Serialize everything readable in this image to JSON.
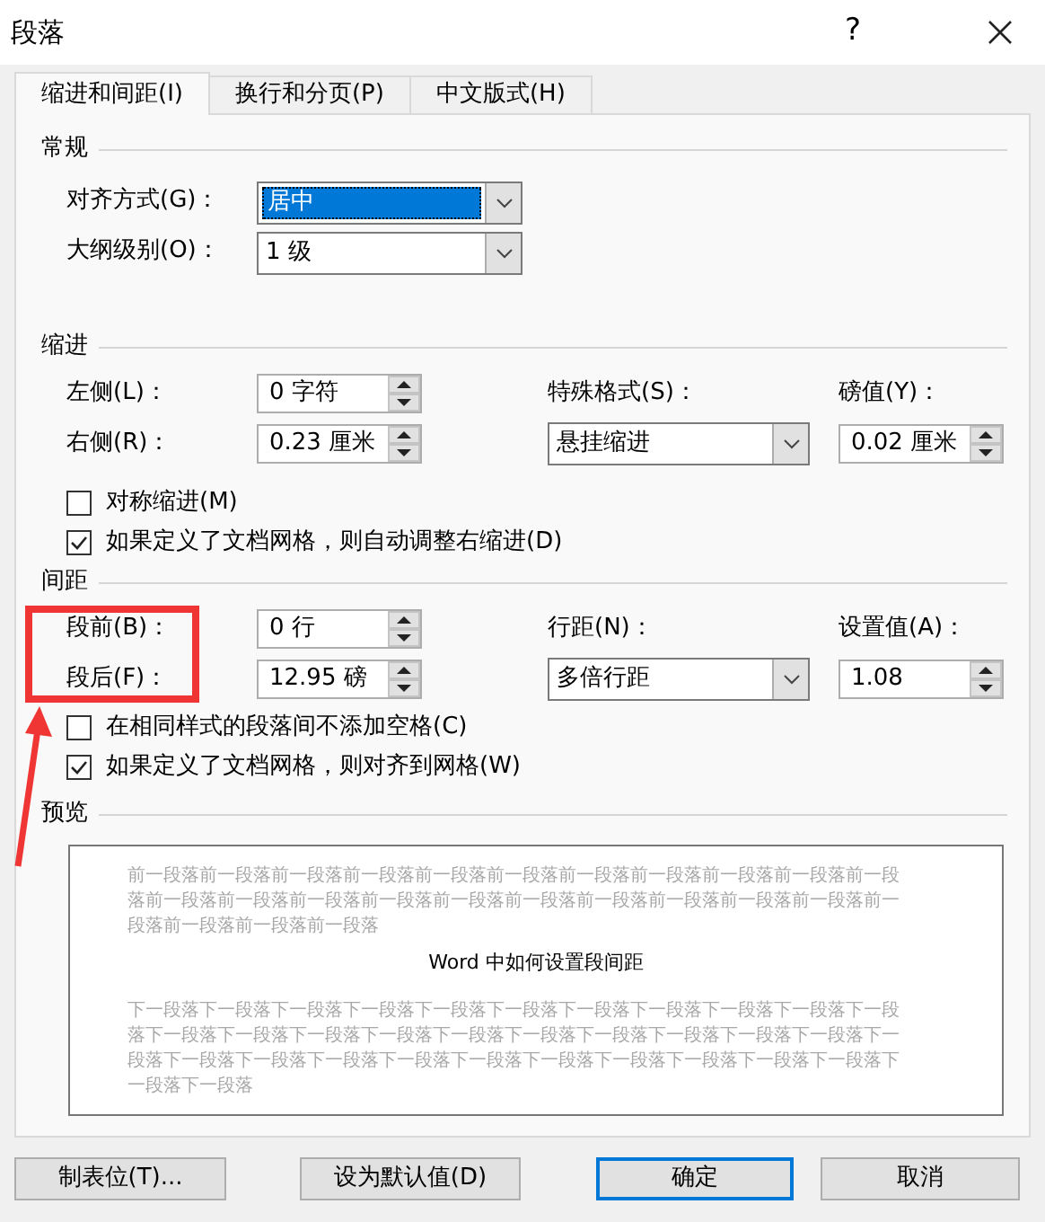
{
  "window": {
    "title": "段落",
    "help": "?"
  },
  "tabs": [
    {
      "label": "缩进和间距(I)",
      "selected": true
    },
    {
      "label": "换行和分页(P)",
      "selected": false
    },
    {
      "label": "中文版式(H)",
      "selected": false
    }
  ],
  "general": {
    "heading": "常规",
    "fields": [
      {
        "label": "对齐方式(G)：",
        "value": "居中",
        "highlighted": true
      },
      {
        "label": "大纲级别(O)：",
        "value": "1 级",
        "highlighted": false
      }
    ]
  },
  "indentation": {
    "heading": "缩进",
    "left": {
      "label": "左侧(L)：",
      "value": "0 字符"
    },
    "right": {
      "label": "右侧(R)：",
      "value": "0.23 厘米"
    },
    "special": {
      "label": "特殊格式(S)：",
      "value": "悬挂缩进"
    },
    "by": {
      "label": "磅值(Y)：",
      "value": "0.02 厘米"
    },
    "checkboxes": [
      {
        "label": "对称缩进(M)",
        "checked": false
      },
      {
        "label": "如果定义了文档网格，则自动调整右缩进(D)",
        "checked": true
      }
    ]
  },
  "spacing": {
    "heading": "间距",
    "before": {
      "label": "段前(B)：",
      "value": "0 行"
    },
    "after": {
      "label": "段后(F)：",
      "value": "12.95 磅"
    },
    "line_spacing": {
      "label": "行距(N)：",
      "value": "多倍行距"
    },
    "at": {
      "label": "设置值(A)：",
      "value": "1.08"
    },
    "checkboxes": [
      {
        "label": "在相同样式的段落间不添加空格(C)",
        "checked": false
      },
      {
        "label": "如果定义了文档网格，则对齐到网格(W)",
        "checked": true
      }
    ]
  },
  "preview": {
    "heading": "预览",
    "previous_lines": [
      "前一段落前一段落前一段落前一段落前一段落前一段落前一段落前一段落前一段落前一段落前一段",
      "落前一段落前一段落前一段落前一段落前一段落前一段落前一段落前一段落前一段落前一段落前一",
      "段落前一段落前一段落前一段落"
    ],
    "sample": "Word 中如何设置段间距",
    "next_lines": [
      "下一段落下一段落下一段落下一段落下一段落下一段落下一段落下一段落下一段落下一段落下一段",
      "落下一段落下一段落下一段落下一段落下一段落下一段落下一段落下一段落下一段落下一段落下一",
      "段落下一段落下一段落下一段落下一段落下一段落下一段落下一段落下一段落下一段落下一段落下",
      "一段落下一段落"
    ]
  },
  "buttons": [
    {
      "label": "制表位(T)...",
      "default": false
    },
    {
      "label": "设为默认值(D)",
      "default": false
    },
    {
      "label": "确定",
      "default": true
    },
    {
      "label": "取消",
      "default": false
    }
  ]
}
